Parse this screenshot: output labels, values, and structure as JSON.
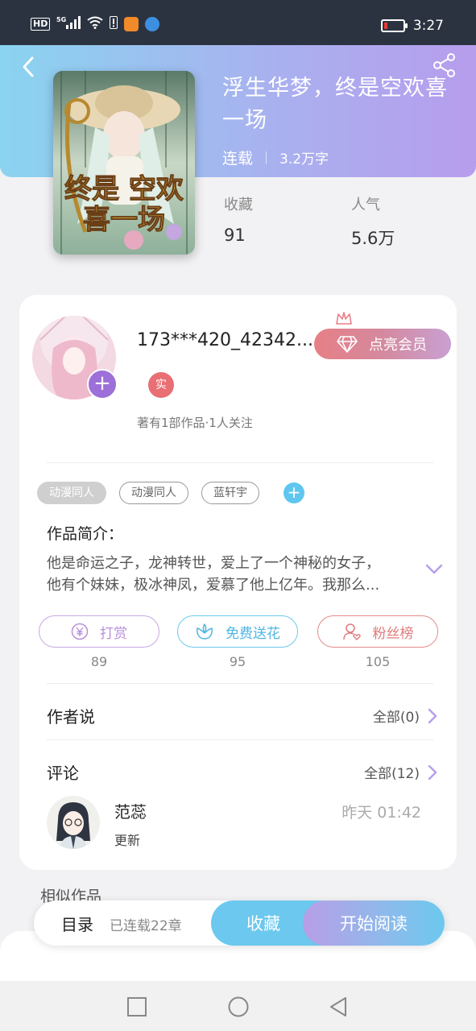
{
  "status_bar": {
    "hd": "HD",
    "network": "5G",
    "time": "3:27",
    "icons": [
      "hd-icon",
      "signal-icon",
      "wifi-icon",
      "alert-icon",
      "app-icon",
      "app-icon-2",
      "battery-icon"
    ]
  },
  "book": {
    "title": "浮生华梦，终是空欢喜一场",
    "status": "连载",
    "words": "3.2万字",
    "cover_text": "终是 空欢喜一场",
    "stats": [
      {
        "label": "收藏",
        "value": "91"
      },
      {
        "label": "人气",
        "value": "5.6万"
      }
    ]
  },
  "author": {
    "name": "173***420_42342...",
    "vip_label": "点亮会员",
    "real_badge": "实",
    "stats": "著有1部作品·1人关注"
  },
  "tags": [
    "动漫同人",
    "动漫同人",
    "蓝轩宇"
  ],
  "intro": {
    "title": "作品简介：",
    "line1": "他是命运之子，龙神转世，爱上了一个神秘的女子，",
    "line2": "他有个妹妹，极冰神凤，爱慕了他上亿年。我那么..."
  },
  "actions": [
    {
      "label": "打赏",
      "count": "89",
      "color": "#b98fdb"
    },
    {
      "label": "免费送花",
      "count": "95",
      "color": "#6cc8ee"
    },
    {
      "label": "粉丝榜",
      "count": "105",
      "color": "#e48a8a"
    }
  ],
  "author_says": {
    "title": "作者说",
    "more": "全部(0)"
  },
  "comments": {
    "title": "评论",
    "more": "全部(12)",
    "first": {
      "user": "范蕊",
      "time": "昨天 01:42",
      "text": "更新"
    }
  },
  "similar_title": "相似作品",
  "bottom_bar": {
    "toc": "目录",
    "chapters": "已连载22章",
    "favorite": "收藏",
    "read": "开始阅读"
  },
  "colors": {
    "header_start": "#8ad4f0",
    "header_end": "#b79ded",
    "accent_blue": "#6cc8ee",
    "accent_purple": "#9d6fd8"
  }
}
